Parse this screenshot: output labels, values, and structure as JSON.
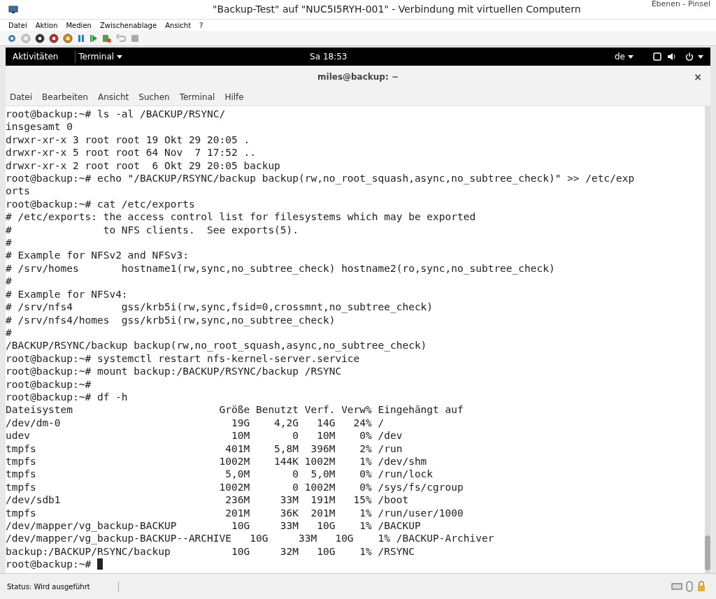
{
  "window": {
    "title": "\"Backup-Test\" auf \"NUC5I5RYH-001\" - Verbindung mit virtuellen Computern",
    "background_title": "Ebenen - Pinsel"
  },
  "menu": [
    "Datei",
    "Aktion",
    "Medien",
    "Zwischenablage",
    "Ansicht",
    "?"
  ],
  "gnome_bar": {
    "activities": "Aktivitäten",
    "app": "Terminal",
    "clock": "Sa 18:53",
    "keyboard": "de"
  },
  "terminal": {
    "title": "miles@backup: ~",
    "close": "×",
    "menu": [
      "Datei",
      "Bearbeiten",
      "Ansicht",
      "Suchen",
      "Terminal",
      "Hilfe"
    ],
    "lines": [
      "root@backup:~# ls -al /BACKUP/RSYNC/",
      "insgesamt 0",
      "drwxr-xr-x 3 root root 19 Okt 29 20:05 .",
      "drwxr-xr-x 5 root root 64 Nov  7 17:52 ..",
      "drwxr-xr-x 2 root root  6 Okt 29 20:05 backup",
      "root@backup:~# echo \"/BACKUP/RSYNC/backup backup(rw,no_root_squash,async,no_subtree_check)\" >> /etc/exp",
      "orts",
      "root@backup:~# cat /etc/exports",
      "# /etc/exports: the access control list for filesystems which may be exported",
      "#               to NFS clients.  See exports(5).",
      "#",
      "# Example for NFSv2 and NFSv3:",
      "# /srv/homes       hostname1(rw,sync,no_subtree_check) hostname2(ro,sync,no_subtree_check)",
      "#",
      "# Example for NFSv4:",
      "# /srv/nfs4        gss/krb5i(rw,sync,fsid=0,crossmnt,no_subtree_check)",
      "# /srv/nfs4/homes  gss/krb5i(rw,sync,no_subtree_check)",
      "#",
      "/BACKUP/RSYNC/backup backup(rw,no_root_squash,async,no_subtree_check)",
      "root@backup:~# systemctl restart nfs-kernel-server.service",
      "root@backup:~# mount backup:/BACKUP/RSYNC/backup /RSYNC",
      "root@backup:~#",
      "root@backup:~# df -h",
      "Dateisystem                        Größe Benutzt Verf. Verw% Eingehängt auf",
      "/dev/dm-0                            19G    4,2G   14G   24% /",
      "udev                                 10M       0   10M    0% /dev",
      "tmpfs                               401M    5,8M  396M    2% /run",
      "tmpfs                              1002M    144K 1002M    1% /dev/shm",
      "tmpfs                               5,0M       0  5,0M    0% /run/lock",
      "tmpfs                              1002M       0 1002M    0% /sys/fs/cgroup",
      "/dev/sdb1                           236M     33M  191M   15% /boot",
      "tmpfs                               201M     36K  201M    1% /run/user/1000",
      "/dev/mapper/vg_backup-BACKUP         10G     33M   10G    1% /BACKUP",
      "/dev/mapper/vg_backup-BACKUP--ARCHIVE   10G     33M   10G    1% /BACKUP-Archiver",
      "backup:/BACKUP/RSYNC/backup          10G     32M   10G    1% /RSYNC"
    ],
    "prompt": "root@backup:~#"
  },
  "status_bar": {
    "text": "Status: Wird ausgeführt"
  }
}
